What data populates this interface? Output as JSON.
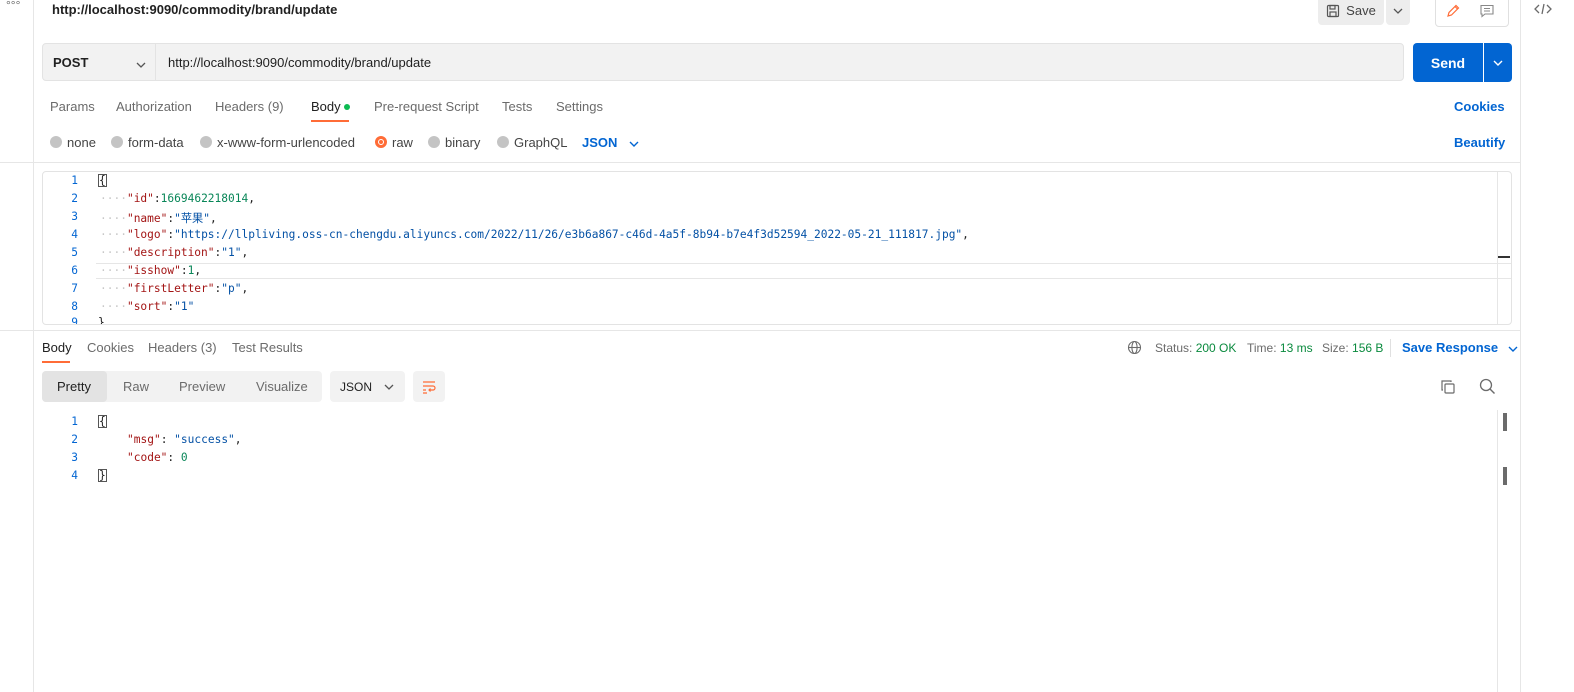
{
  "window": {
    "request_title": "http://localhost:9090/commodity/brand/update",
    "more_icon": "ellipsis-icon",
    "code_icon": "code-icon"
  },
  "toolbar": {
    "save_label": "Save"
  },
  "request": {
    "method": "POST",
    "url": "http://localhost:9090/commodity/brand/update",
    "send_label": "Send"
  },
  "tabs": {
    "items": [
      "Params",
      "Authorization",
      "Headers (9)",
      "Body",
      "Pre-request Script",
      "Tests",
      "Settings"
    ],
    "active": "Body",
    "cookies": "Cookies"
  },
  "body_options": {
    "modes": [
      "none",
      "form-data",
      "x-www-form-urlencoded",
      "raw",
      "binary",
      "GraphQL"
    ],
    "selected": "raw",
    "format": "JSON",
    "beautify": "Beautify"
  },
  "request_body": {
    "line_numbers": [
      "1",
      "2",
      "3",
      "4",
      "5",
      "6",
      "7",
      "8",
      "9"
    ],
    "lines": [
      "{",
      "\"id\":1669462218014,",
      "\"name\":\"苹果\",",
      "\"logo\":\"https://llpliving.oss-cn-chengdu.aliyuncs.com/2022/11/26/e3b6a867-c46d-4a5f-8b94-b7e4f3d52594_2022-05-21_111817.jpg\",",
      "\"description\":\"1\",",
      "\"isshow\":1,",
      "\"firstLetter\":\"p\",",
      "\"sort\":\"1\"",
      "}"
    ]
  },
  "response": {
    "tabs": [
      "Body",
      "Cookies",
      "Headers (3)",
      "Test Results"
    ],
    "active": "Body",
    "status_label": "Status:",
    "status": "200 OK",
    "time_label": "Time:",
    "time": "13 ms",
    "size_label": "Size:",
    "size": "156 B",
    "save_response": "Save Response",
    "views": [
      "Pretty",
      "Raw",
      "Preview",
      "Visualize"
    ],
    "active_view": "Pretty",
    "format": "JSON",
    "line_numbers": [
      "1",
      "2",
      "3",
      "4"
    ],
    "lines": [
      "{",
      "\"msg\": \"success\",",
      "\"code\": 0",
      "}"
    ]
  },
  "colors": {
    "accent": "#ff6c37",
    "primary": "#0265d2",
    "success": "#0a8a3e"
  }
}
